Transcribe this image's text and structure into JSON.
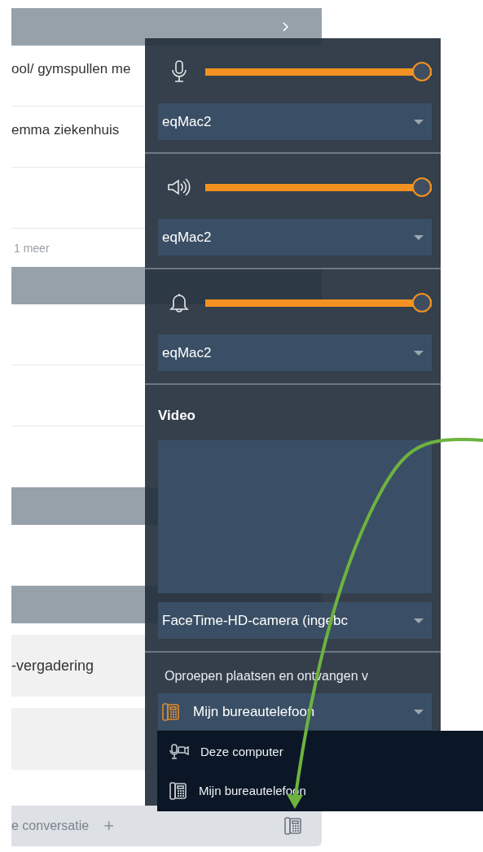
{
  "list": {
    "rows": [
      {
        "kind": "header",
        "chevron": true
      },
      {
        "kind": "row",
        "text": "ool/ gymspullen me"
      },
      {
        "kind": "row",
        "text": "emma ziekenhuis"
      },
      {
        "kind": "row"
      },
      {
        "kind": "more",
        "text": "1 meer"
      },
      {
        "kind": "header"
      },
      {
        "kind": "row"
      },
      {
        "kind": "row"
      },
      {
        "kind": "row"
      },
      {
        "kind": "header"
      },
      {
        "kind": "row"
      },
      {
        "kind": "header"
      },
      {
        "kind": "card",
        "text": "-vergadering"
      },
      {
        "kind": "card"
      }
    ]
  },
  "footer": {
    "text": "e conversatie",
    "add": "+"
  },
  "audio": [
    {
      "kind": "microphone",
      "level": 1,
      "device": "eqMac2"
    },
    {
      "kind": "speaker",
      "level": 1,
      "device": "eqMac2"
    },
    {
      "kind": "bell",
      "level": 1,
      "device": "eqMac2"
    }
  ],
  "video": {
    "title": "Video",
    "device": "FaceTime-HD-camera (ingebc"
  },
  "calls": {
    "label": "Oproepen plaatsen en ontvangen v",
    "device": "Mijn bureautelefoon"
  },
  "menu": [
    {
      "kind": "computer",
      "label": "Deze computer"
    },
    {
      "kind": "desk-phone",
      "label": "Mijn bureautelefoon"
    }
  ]
}
